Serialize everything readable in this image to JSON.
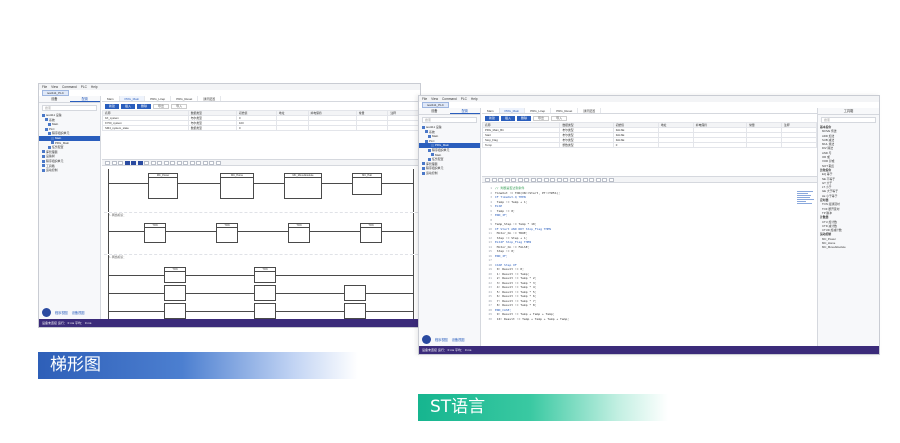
{
  "left_window": {
    "menu": [
      "File",
      "View",
      "Command",
      "PLC",
      "Help"
    ],
    "title_tab": "test111_PLC",
    "sidebar_tabs": [
      "设备",
      "配置"
    ],
    "search_placeholder": "搜索",
    "tree": [
      "test111 设备",
      "系统",
      "Main",
      "PLC",
      "程序组织单元",
      "Main",
      "PRG_Main",
      "任务配置",
      "库管理器",
      "设备树",
      "程序组织单元",
      "工具箱",
      "运动控制"
    ],
    "footer": [
      "程序视图",
      "设备视图"
    ],
    "doc_tabs": [
      "Main",
      "PRG_Main",
      "PRG_Ltrep",
      "PRG_Reset",
      "通讯配置"
    ],
    "buttons": [
      "新建",
      "插入",
      "删除",
      "导出",
      "导入"
    ],
    "table_headers": [
      "名称",
      "数据类型",
      "初始值",
      "地址",
      "掉电保持",
      "常量",
      "注释"
    ],
    "table_rows": [
      [
        "bX_system",
        "布尔类型",
        "0"
      ],
      [
        "bY50_system",
        "布尔类型",
        "100"
      ],
      [
        "SM4_system_state",
        "数据类型",
        "0"
      ]
    ],
    "rungs": [
      "1 - 网络标识：",
      "2 - 网络标识：",
      "3 - 网络标识："
    ],
    "blocks": [
      "MC_Power",
      "MC_Home",
      "MC_MoveAbsolute",
      "MC_Halt",
      "TON",
      "TON",
      "TON",
      "TON",
      "TON",
      "TON"
    ],
    "status": "设备未连接  运行：  0 ms  平均：  0 ms"
  },
  "right_window": {
    "menu": [
      "File",
      "View",
      "Command",
      "PLC",
      "Help"
    ],
    "title_tab": "test111_PLC",
    "sidebar_tabs": [
      "设备",
      "配置"
    ],
    "search_placeholder": "搜索",
    "tree": [
      "test111 设备",
      "系统",
      "Main",
      "PLC",
      "PRG_Main",
      "程序组织单元",
      "Main",
      "任务配置",
      "库管理器",
      "程序组织单元",
      "运动控制"
    ],
    "footer": [
      "程序视图",
      "设备视图"
    ],
    "doc_tabs": [
      "Main",
      "PRG_Main",
      "PRG_Ltrep",
      "PRG_Reset",
      "通讯配置"
    ],
    "buttons": [
      "新建",
      "插入",
      "删除",
      "导出",
      "导入"
    ],
    "table_headers": [
      "名称",
      "数据类型",
      "初始值",
      "地址",
      "掉电保持",
      "常量",
      "注释"
    ],
    "table_rows": [
      [
        "PRG_Main_Bit",
        "布尔类型",
        "FALSE"
      ],
      [
        "Start",
        "布尔类型",
        "FALSE"
      ],
      [
        "Stop_Flag",
        "布尔类型",
        "FALSE"
      ],
      [
        "Temp",
        "整数类型",
        "0"
      ]
    ],
    "code": [
      "// 判断是否达到条件",
      "TimeOut := TON(IN:=Start, PT:=T#5S);",
      "IF TimeOut.Q THEN",
      "  Temp := Temp + 1;",
      "ELSE",
      "  Temp := 0;",
      "END_IF;",
      "",
      "Temp_Step := Temp * 10;",
      "IF Start AND NOT Stop_Flag THEN",
      "  Motor_On := TRUE;",
      "  Step := Step + 1;",
      "ELSIF Stop_Flag THEN",
      "  Motor_On := FALSE;",
      "  Step := 0;",
      "END_IF;",
      "",
      "CASE Step OF",
      "  0: Result := 0;",
      "  1: Result := Temp;",
      "  2: Result := Temp * 2;",
      "  3: Result := Temp * 3;",
      "  4: Result := Temp * 4;",
      "  5: Result := Temp * 5;",
      "  6: Result := Temp * 6;",
      "  7: Result := Temp * 7;",
      "  8: Result := Temp * 8;",
      "END_CASE;",
      "  9: Result := Temp + Temp + Temp;",
      "  10: Result := Temp + Temp + Temp + Temp;"
    ],
    "panel_title": "工具箱",
    "panel_items": [
      "基本指令",
      "MOVE 传送",
      "ADD 加法",
      "SUB 减法",
      "MUL 乘法",
      "DIV 除法",
      "AND 与",
      "OR 或",
      "XOR 异或",
      "NOT 取反",
      "比较指令",
      "EQ 等于",
      "NE 不等于",
      "GT 大于",
      "LT 小于",
      "GE 大于等于",
      "LE 小于等于",
      "定时器",
      "TON 接通延时",
      "TOF 断开延时",
      "TP 脉冲",
      "计数器",
      "CTU 加计数",
      "CTD 减计数",
      "CTUD 加减计数",
      "运动控制",
      "MC_Power",
      "MC_Home",
      "MC_MoveAbsolute"
    ],
    "status": "设备未连接  运行：  0 ms  平均：  0 ms"
  },
  "labels": {
    "ladder": "梯形图",
    "st": "ST语言"
  },
  "colors": {
    "accent": "#2a5ebd",
    "status_bar": "#3b2b7a",
    "banner_left": "#2e5fb8",
    "banner_right": "#16b58f"
  }
}
